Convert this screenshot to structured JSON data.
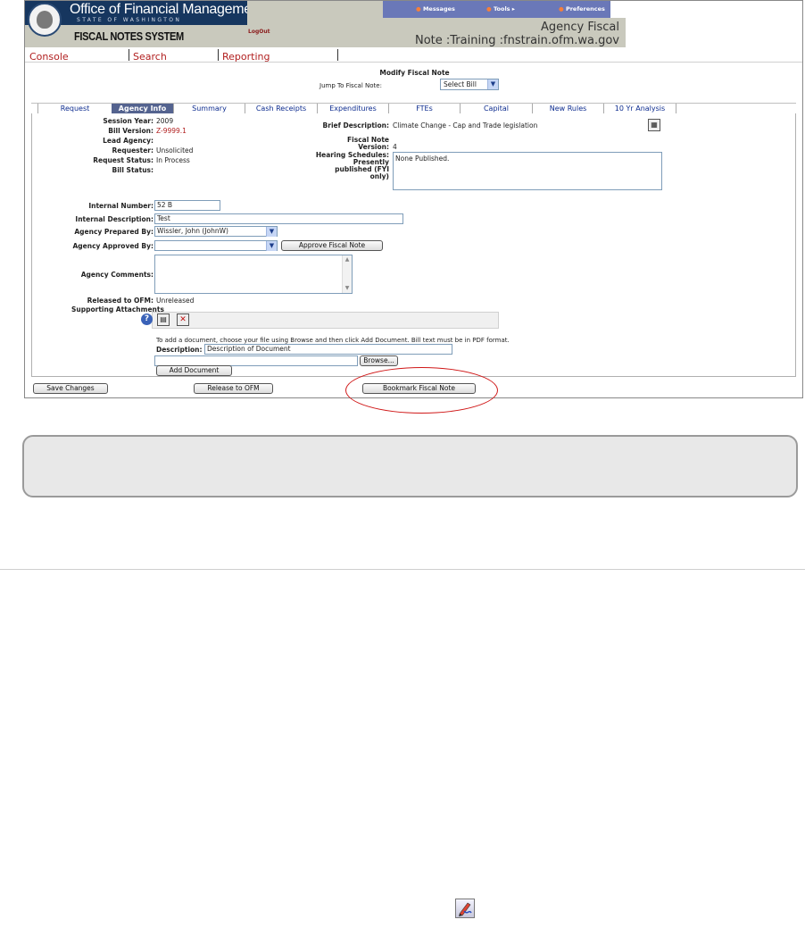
{
  "header": {
    "org_title": "Office of Financial Management",
    "org_subtitle": "STATE OF WASHINGTON",
    "system_title": "FISCAL NOTES SYSTEM",
    "logout": "LogOut",
    "top_nav": [
      {
        "label": "Messages"
      },
      {
        "label": "Tools ▸"
      },
      {
        "label": "Preferences"
      }
    ],
    "env_line1": "Agency Fiscal",
    "env_line2": "Note :Training :fnstrain.ofm.wa.gov"
  },
  "nav": {
    "items": [
      "Console",
      "Search",
      "Reporting"
    ]
  },
  "page": {
    "heading": "Modify Fiscal Note",
    "jump_label": "Jump To Fiscal Note:",
    "jump_value": "Select Bill"
  },
  "tabs": [
    {
      "label": "Request"
    },
    {
      "label": "Agency Info",
      "active": true
    },
    {
      "label": "Summary"
    },
    {
      "label": "Cash Receipts"
    },
    {
      "label": "Expenditures"
    },
    {
      "label": "FTEs"
    },
    {
      "label": "Capital"
    },
    {
      "label": "New Rules"
    },
    {
      "label": "10 Yr Analysis"
    }
  ],
  "info": {
    "session_year_label": "Session Year:",
    "session_year": "2009",
    "bill_version_label": "Bill Version:",
    "bill_version": "Z-9999.1",
    "lead_agency_label": "Lead Agency:",
    "requester_label": "Requester:",
    "requester": "Unsolicited",
    "request_status_label": "Request Status:",
    "request_status": "In Process",
    "bill_status_label": "Bill Status:",
    "brief_desc_label": "Brief Description:",
    "brief_desc": "Climate Change - Cap and Trade legislation",
    "fn_version_label_1": "Fiscal Note",
    "fn_version_label_2": "Version:",
    "fn_version": "4",
    "hearing_label_1": "Hearing Schedules:",
    "hearing_label_2": "Presently",
    "hearing_label_3": "published (FYI",
    "hearing_label_4": "only)",
    "hearing_value": "None Published."
  },
  "form": {
    "internal_number_label": "Internal Number:",
    "internal_number": "52 B",
    "internal_desc_label": "Internal Description:",
    "internal_desc": "Test",
    "prepared_by_label": "Agency Prepared By:",
    "prepared_by": "Wissler, John (JohnW)",
    "approved_by_label": "Agency Approved By:",
    "approved_by": "",
    "approve_button": "Approve Fiscal Note",
    "comments_label": "Agency Comments:",
    "released_label": "Released to OFM:",
    "released_value": "Unreleased",
    "attachments_label": "Supporting Attachments",
    "instructions": "To add a document, choose your file using Browse and then click Add Document. Bill text must be in PDF format.",
    "description_label": "Description:",
    "description_value": "Description of Document",
    "browse_button": "Browse...",
    "add_doc_button": "Add Document"
  },
  "actions": {
    "save": "Save Changes",
    "release": "Release to OFM",
    "bookmark": "Bookmark Fiscal Note"
  },
  "colors": {
    "header_navy": "#16365f",
    "header_gray": "#c9c9bd",
    "topnav_blue": "#6a78b8",
    "tab_active": "#54638f",
    "nav_red": "#b11f1f",
    "callout_red": "#d01818"
  }
}
